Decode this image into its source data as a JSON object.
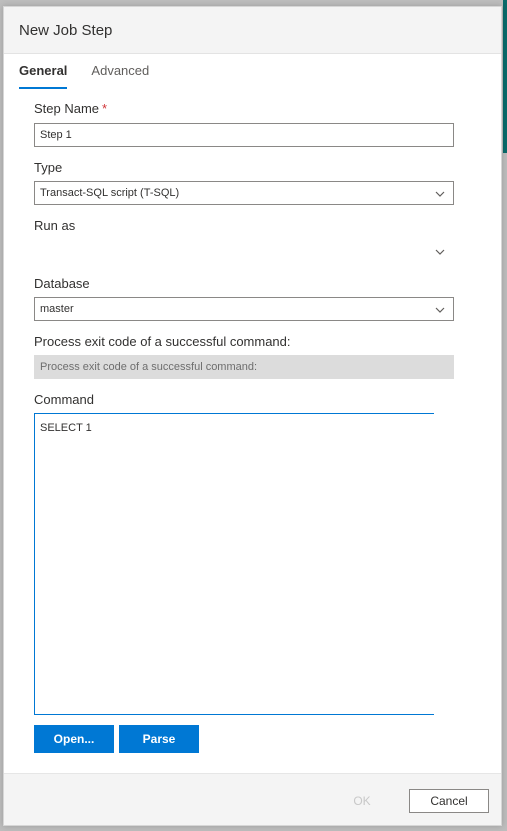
{
  "dialog": {
    "title": "New Job Step"
  },
  "tabs": [
    {
      "label": "General",
      "active": true
    },
    {
      "label": "Advanced",
      "active": false
    }
  ],
  "fields": {
    "step_name": {
      "label": "Step Name",
      "required_mark": "*",
      "value": "Step 1"
    },
    "type": {
      "label": "Type",
      "value": "Transact-SQL script (T-SQL)"
    },
    "run_as": {
      "label": "Run as",
      "value": ""
    },
    "database": {
      "label": "Database",
      "value": "master"
    },
    "exit_code": {
      "label": "Process exit code of a successful command:",
      "placeholder": "Process exit code of a successful command:"
    },
    "command": {
      "label": "Command",
      "value": "SELECT 1"
    }
  },
  "buttons": {
    "open": "Open...",
    "parse": "Parse",
    "ok": "OK",
    "cancel": "Cancel"
  },
  "colors": {
    "accent": "#0078d4",
    "required": "#d13438"
  },
  "icons": {
    "dropdown": "chevron-down-icon"
  }
}
